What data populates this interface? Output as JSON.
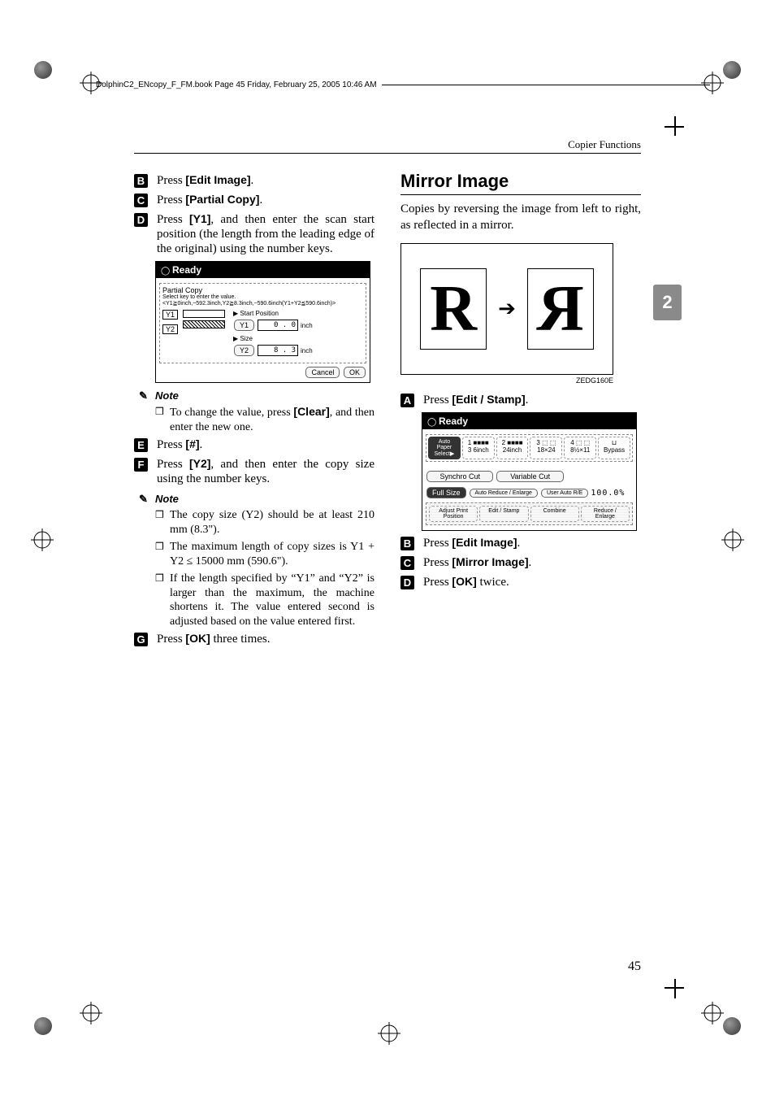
{
  "header": {
    "book_info": "DolphinC2_ENcopy_F_FM.book  Page 45  Friday, February 25, 2005  10:46 AM",
    "running_head": "Copier Functions"
  },
  "page_number": "45",
  "side_tab": "2",
  "left": {
    "step2": {
      "num": "B",
      "text_a": "Press ",
      "bold": "[Edit Image]",
      "text_b": "."
    },
    "step3": {
      "num": "C",
      "text_a": "Press ",
      "bold": "[Partial Copy]",
      "text_b": "."
    },
    "step4": {
      "num": "D",
      "text_a": "Press ",
      "bold": "[Y1]",
      "text_b": ", and then enter the scan start position (the length from the leading edge of the original) using the number keys."
    },
    "panelA": {
      "ready": "Ready",
      "mode": "Partial Copy",
      "instr": "Select key to enter the value.",
      "range": "<Y1≧0inch,~592.3inch,Y2≧8.3inch,~590.6inch(Y1+Y2≦590.6inch)>",
      "startpos": "▶ Start Position",
      "size_lbl": "▶ Size",
      "y1_lab": "Y1",
      "y2_lab": "Y2",
      "y1_field_lab": "Y1",
      "y1_val": "0 . 0",
      "y2_field_lab": "Y2",
      "y2_val": "8 . 3",
      "unit": "inch",
      "cancel": "Cancel",
      "ok": "OK"
    },
    "note1_head": "Note",
    "note1_item": "To change the value, press ",
    "note1_bold": "[Clear]",
    "note1_item_b": ", and then enter the new one.",
    "step5": {
      "num": "E",
      "text_a": "Press ",
      "bold": "[#]",
      "text_b": "."
    },
    "step6": {
      "num": "F",
      "text_a": "Press ",
      "bold": "[Y2]",
      "text_b": ", and then enter the copy size using the number keys."
    },
    "note2_head": "Note",
    "note2_a": "The copy size (Y2) should be at least 210 mm (8.3\").",
    "note2_b": "The maximum length of copy sizes is Y1 + Y2 ≤ 15000 mm (590.6\").",
    "note2_c": "If the length specified by “Y1” and “Y2” is larger than the maximum, the machine shortens it. The value entered second is adjusted based on the value entered first.",
    "step7": {
      "num": "G",
      "text_a": "Press ",
      "bold": "[OK]",
      "text_b": " three times."
    }
  },
  "right": {
    "title": "Mirror Image",
    "desc": "Copies by reversing the image from left to right, as reflected in a mirror.",
    "figR": "R",
    "fig_code": "ZEDG160E",
    "step1": {
      "num": "A",
      "text_a": "Press ",
      "bold": "[Edit / Stamp]",
      "text_b": "."
    },
    "panelB": {
      "ready": "Ready",
      "auto_paper": "Auto Paper Select▶",
      "t1": "1 ■■■■\n3 6inch",
      "t2": "2 ■■■■\n24inch",
      "t3": "3 ⬚ ⬚\n18×24",
      "t4": "4 ⬚ ⬚\n8½×11",
      "bypass": "⊔\nBypass",
      "synchro": "Synchro Cut",
      "variable": "Variable Cut",
      "full": "Full Size",
      "auto_re": "Auto Reduce / Enlarge",
      "user_re": "User Auto R/E",
      "ratio": "100.0%",
      "adjpos": "Adjust Print Position",
      "editstamp": "Edit / Stamp",
      "combine": "Combine",
      "reduce": "Reduce / Enlarge"
    },
    "step2": {
      "num": "B",
      "text_a": "Press ",
      "bold": "[Edit Image]",
      "text_b": "."
    },
    "step3": {
      "num": "C",
      "text_a": "Press ",
      "bold": "[Mirror Image]",
      "text_b": "."
    },
    "step4": {
      "num": "D",
      "text_a": "Press ",
      "bold": "[OK]",
      "text_b": " twice."
    }
  }
}
